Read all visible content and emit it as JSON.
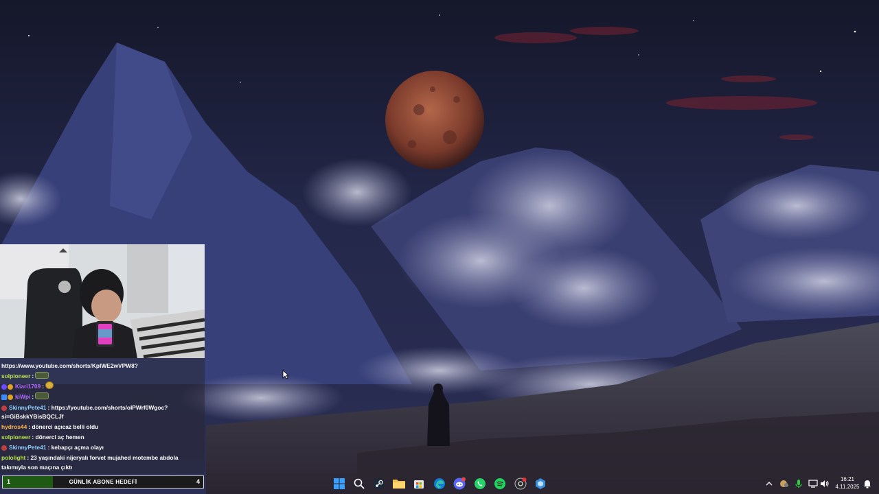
{
  "chat": {
    "messages": [
      {
        "user": "",
        "text": "https://www.youtube.com/shorts/KpIWE2wVPW8?",
        "user_color": "#ffffff"
      },
      {
        "user": "solpioneer",
        "sep": ":",
        "text": "",
        "user_color": "#b9e34a",
        "emote": "tank"
      },
      {
        "user": "Kiari1709",
        "sep": ":",
        "text": "",
        "user_color": "#b46cff",
        "emote": "cheese"
      },
      {
        "user": "kiWpi",
        "sep": ":",
        "text": "",
        "user_color": "#b46cff",
        "emote": "tank"
      },
      {
        "user": "SkinnyPete41",
        "sep": ":",
        "text": "https://youtube.com/shorts/oIPWrf0Wgoc?",
        "cont": "si=GiBskkYBisBQCLJf",
        "user_color": "#8fd0ff"
      },
      {
        "user": "hydros44",
        "sep": ":",
        "text": "dönerci açıcaz belli oldu",
        "user_color": "#ffb347"
      },
      {
        "user": "solpioneer",
        "sep": ":",
        "text": "dönerci aç hemen",
        "user_color": "#b9e34a"
      },
      {
        "user": "SkinnyPete41",
        "sep": ":",
        "text": "kebapçı açma olayı",
        "user_color": "#8fd0ff"
      },
      {
        "user": "pololight",
        "sep": ":",
        "text": "23 yaşındaki nijeryalı forvet mujahed motembe abdola takımıyla son maçına çıktı",
        "user_color": "#b9e34a"
      }
    ]
  },
  "goal": {
    "current": "1",
    "label": "GÜNLİK ABONE HEDEFİ",
    "target": "4",
    "progress": 0.25
  },
  "taskbar": {
    "icons": [
      "windows-start-icon",
      "search-icon",
      "steam-icon",
      "file-explorer-icon",
      "microsoft-store-icon",
      "edge-icon",
      "discord-icon",
      "whatsapp-icon",
      "spotify-icon",
      "app-icon",
      "network-app-icon"
    ],
    "tray": [
      "show-hidden-icons-icon",
      "app-tray-icon",
      "microphone-icon",
      "network-icon",
      "volume-icon"
    ],
    "time": "16:21",
    "date": "4.11.2025"
  },
  "colors": {
    "goal_fill": "#1e5a14",
    "chat_bg": "rgba(40,40,52,0.55)"
  }
}
